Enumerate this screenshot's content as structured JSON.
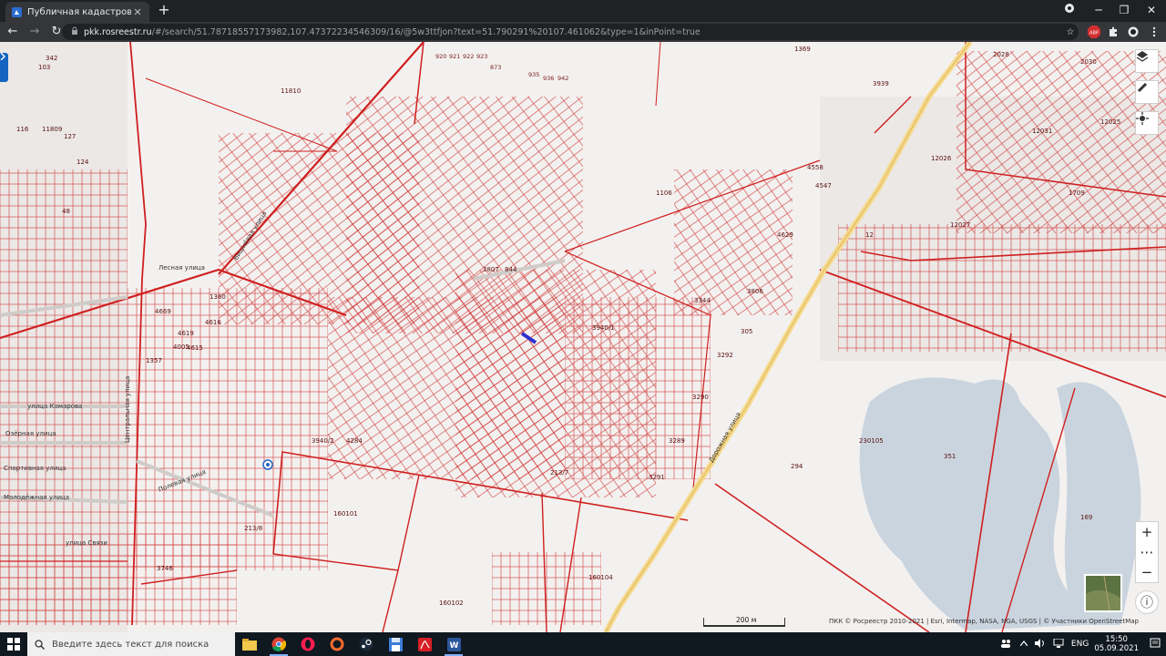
{
  "browser": {
    "tab_title": "Публичная кадастровая карта",
    "tab_close": "✕",
    "new_tab": "+",
    "url_host": "pkk.rosreestr.ru",
    "url_path": "/#/search/51.78718557173982,107.47372234546309/16/@5w3ttfjon?text=51.790291%20107.461062&type=1&inPoint=true",
    "back": "←",
    "forward": "→",
    "reload": "↻",
    "minimize": "─",
    "maximize": "❐",
    "close": "✕",
    "lock": "🔒",
    "star": "☆",
    "abp": "ABP"
  },
  "map": {
    "parcels": [
      "920",
      "921",
      "922",
      "923",
      "873",
      "935",
      "936",
      "942",
      "1369",
      "3939",
      "11810",
      "116",
      "11809",
      "127",
      "124",
      "48",
      "103",
      "342",
      "1106",
      "3807",
      "844",
      "4629",
      "3806",
      "3344",
      "3940/1",
      "305",
      "3292",
      "3290",
      "3289",
      "3291",
      "3940/2",
      "4284",
      "160101",
      "160102",
      "160104",
      "213/8",
      "213/7",
      "230105",
      "351",
      "294",
      "169",
      "12026",
      "12027",
      "12025",
      "12031",
      "2028",
      "2030",
      "1709",
      "4558",
      "4547",
      "3746",
      "4619",
      "4615",
      "4616",
      "4005",
      "1357",
      "1360",
      "4669",
      "12"
    ],
    "streets": [
      "Вишнёвая улица",
      "Лесная улица",
      "улица Комарова",
      "Озёрная улица",
      "Спортивная улица",
      "Молодёжная улица",
      "улица Связи",
      "Полевая улица",
      "Дорожная улица",
      "Центральная улица"
    ],
    "scale_label": "200 м",
    "attribution": "ПКК © Росреестр 2010-2021 | Esri, Intermap, NASA, NGA, USGS | © Участники OpenStreetMap",
    "zoom_in": "+",
    "zoom_more": "⋯",
    "zoom_out": "−",
    "info": "ⓘ"
  },
  "taskbar": {
    "search_placeholder": "Введите здесь текст для поиска",
    "lang": "ENG",
    "time": "15:50",
    "date": "05.09.2021"
  }
}
